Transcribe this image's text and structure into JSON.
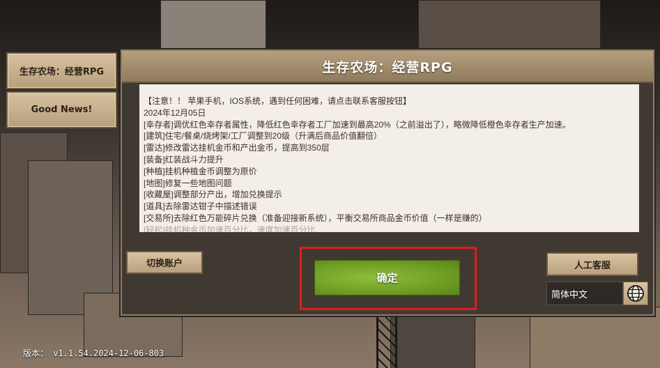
{
  "side_buttons": {
    "farm_label": "生存农场：经营RPG",
    "news_label": "Good News!"
  },
  "dialog": {
    "title": "生存农场：经营RPG",
    "notice_lines": [
      "【注意！！ 苹果手机，IOS系统，遇到任何困难，请点击联系客服按钮】",
      "2024年12月05日",
      "[幸存者]调优红色幸存者属性，降低红色幸存者工厂加速到最高20%（之前溢出了），略微降低橙色幸存者生产加速。",
      "[建筑]住宅/餐桌/烧烤架/工厂调整到20级（升满后商品价值翻倍）",
      "[雷达]修改雷达挂机金币和产出金币，提高到350层",
      "[装备]红装战斗力提升",
      "[种植]挂机种植金币调整为原价",
      "[地图]修复一些地图问题",
      "[收藏屋]调整部分产出，增加兑换提示",
      "[道具]去除雷达钳子中描述错误",
      "[交易所]去除红色万能碎片兑换（准备迎接新系统），平衡交易所商品金币价值（一样是赚的）",
      "[轻松]挂机种金币加速百分比，速度加速百分比"
    ],
    "switch_account_label": "切换账户",
    "ok_label": "确定",
    "customer_service_label": "人工客服",
    "language_value": "简体中文"
  },
  "version_text": "版本： v1.1.54.2024-12-06-803",
  "colors": {
    "ok_green": "#7aaa2c",
    "highlight_red": "#e11d1d",
    "panel_brown": "#403932"
  }
}
